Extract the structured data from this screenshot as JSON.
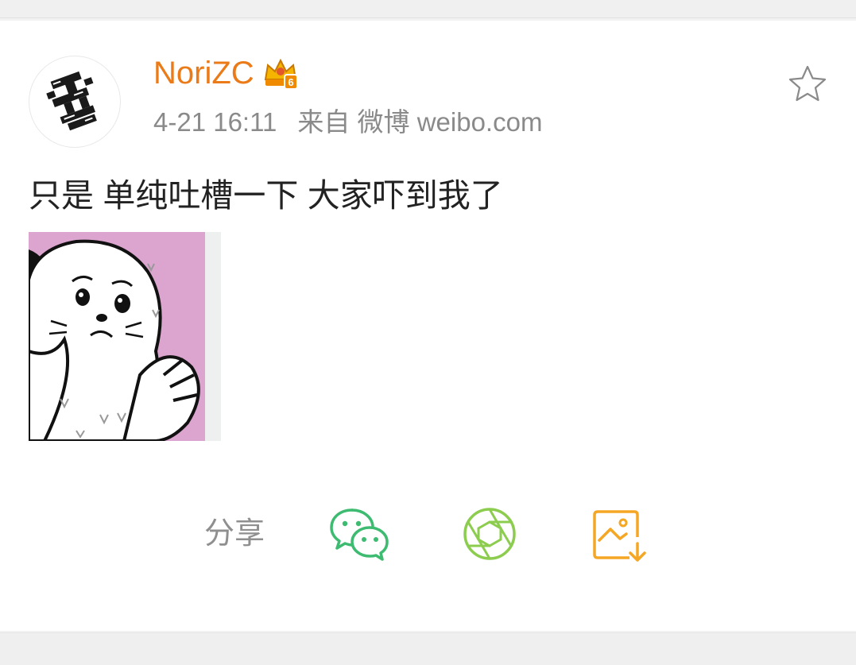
{
  "post": {
    "username": "NoriZC",
    "time": "4-21 16:11",
    "source": "来自 微博 weibo.com",
    "text": "只是 单纯吐槽一下 大家吓到我了"
  },
  "icons": {
    "badge": "crown-vip-icon",
    "favorite": "star-outline-icon",
    "wechat": "wechat-icon",
    "moments": "moments-shutter-icon",
    "save_image": "save-image-icon"
  },
  "share": {
    "label": "分享"
  },
  "colors": {
    "username": "#eb7a18",
    "wechat": "#3dbb70",
    "moments": "#8ccc4e",
    "save_image": "#f5a623",
    "image_bg": "#dca5cf"
  }
}
